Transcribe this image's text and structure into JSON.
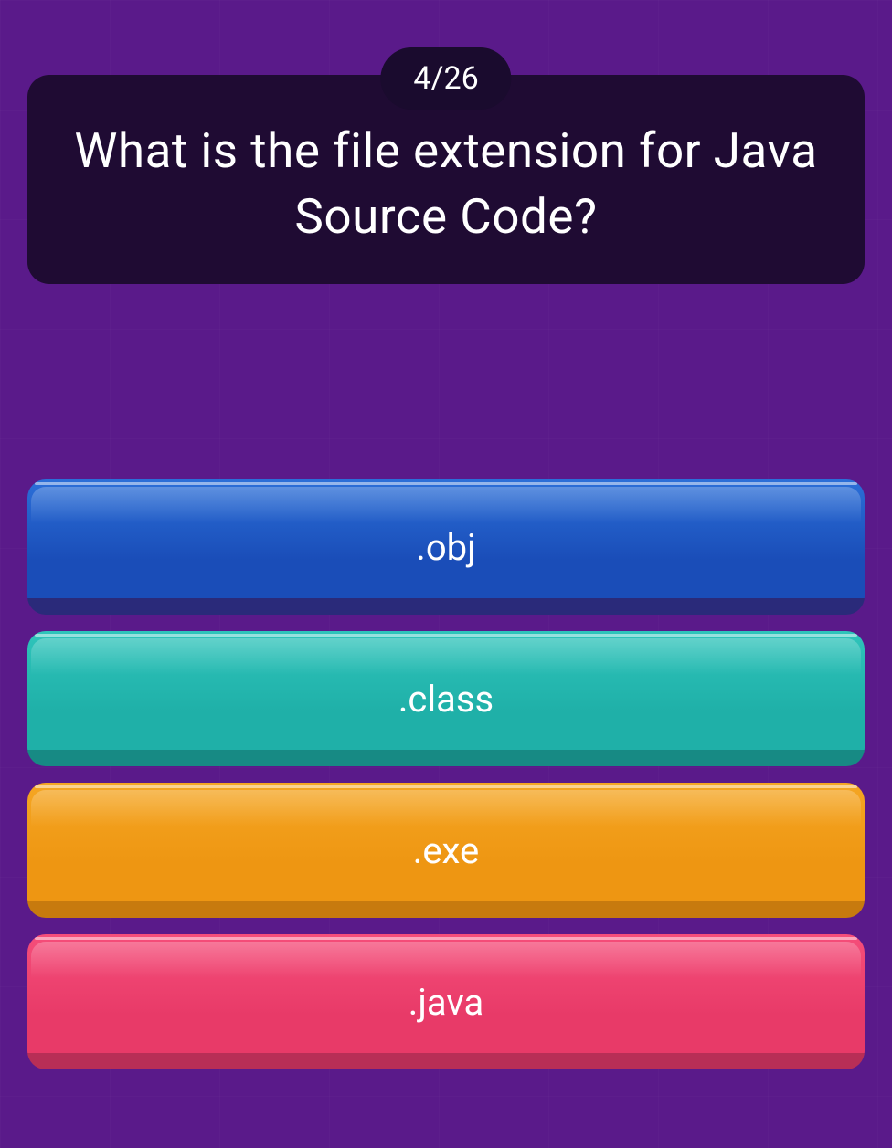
{
  "progress": {
    "current": 4,
    "total": 26,
    "label": "4/26"
  },
  "question": {
    "text": "What is the file extension for Java Source Code?"
  },
  "answers": [
    {
      "label": ".obj",
      "color": "blue"
    },
    {
      "label": ".class",
      "color": "teal"
    },
    {
      "label": ".exe",
      "color": "orange"
    },
    {
      "label": ".java",
      "color": "pink"
    }
  ]
}
